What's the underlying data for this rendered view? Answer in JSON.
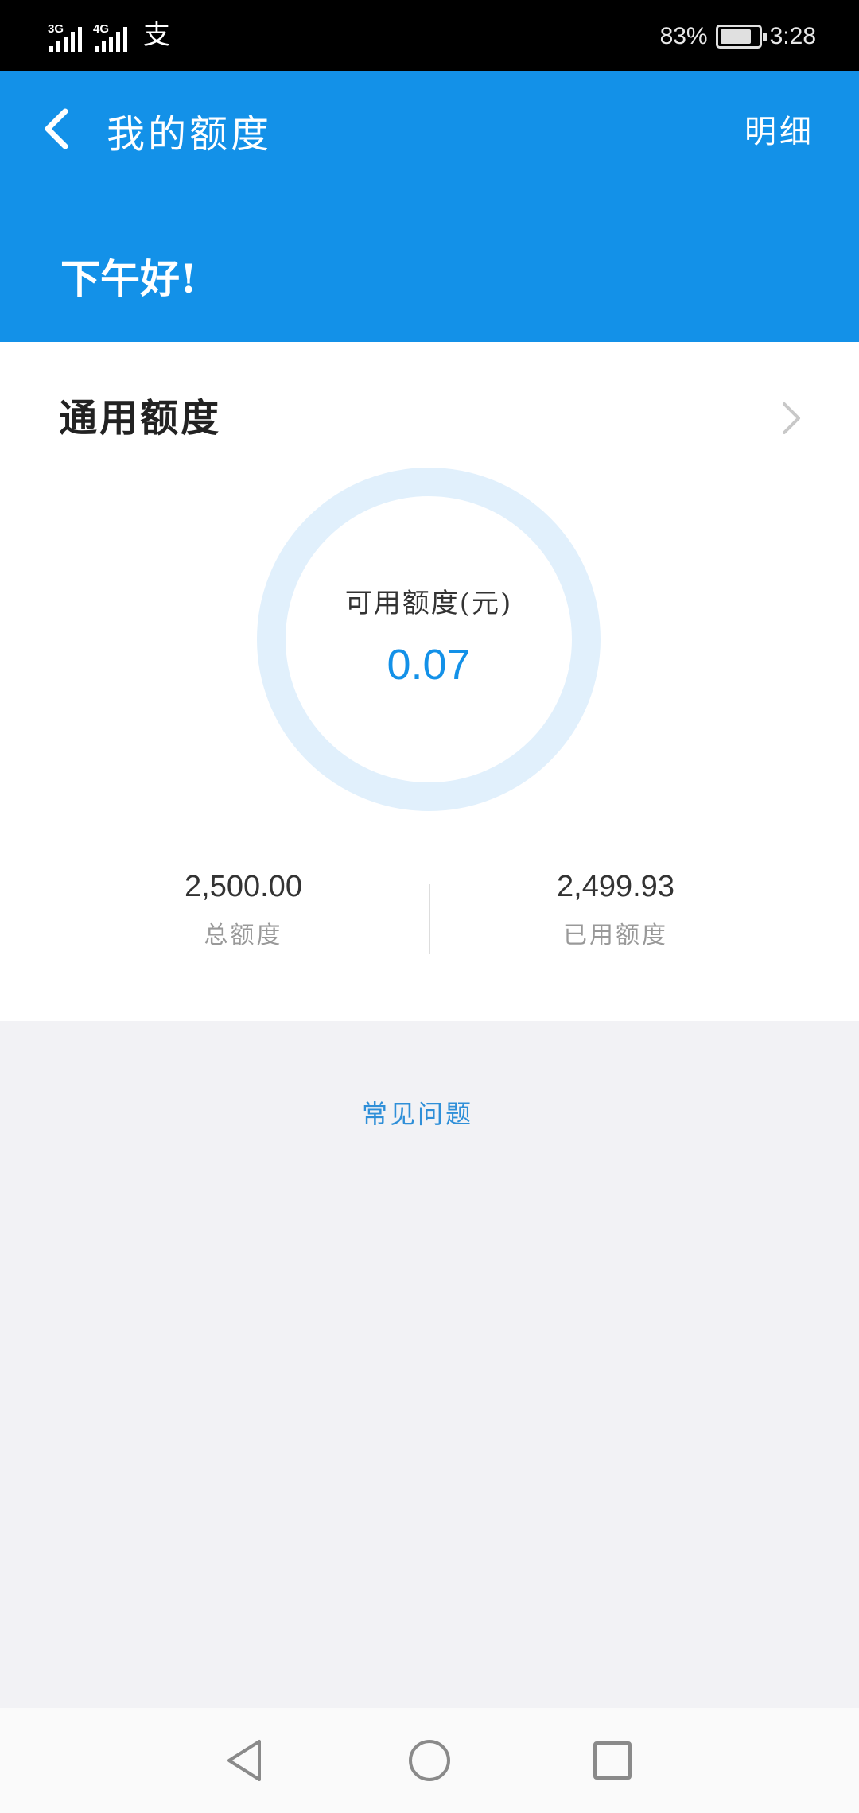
{
  "status_bar": {
    "network_1": "3G",
    "network_2": "4G",
    "app_notification_glyph": "支",
    "battery_percent": "83%",
    "battery_level": 0.83,
    "time": "3:28"
  },
  "header": {
    "title": "我的额度",
    "detail_label": "明细",
    "greeting": "下午好!",
    "background_color": "#1391e8"
  },
  "credit": {
    "section_title": "通用额度",
    "available_label": "可用额度(元)",
    "available_value": "0.07",
    "available_ratio": 3e-05,
    "total_value": "2,500.00",
    "total_label": "总额度",
    "used_value": "2,499.93",
    "used_label": "已用额度",
    "accent_color": "#1391e8",
    "ring_track_color": "#e1f0fc"
  },
  "faq": {
    "label": "常见问题"
  },
  "icons": {
    "back": "chevron-left-icon",
    "section_arrow": "chevron-right-icon",
    "nav_back": "triangle-back-icon",
    "nav_home": "circle-home-icon",
    "nav_recent": "square-recent-icon"
  }
}
